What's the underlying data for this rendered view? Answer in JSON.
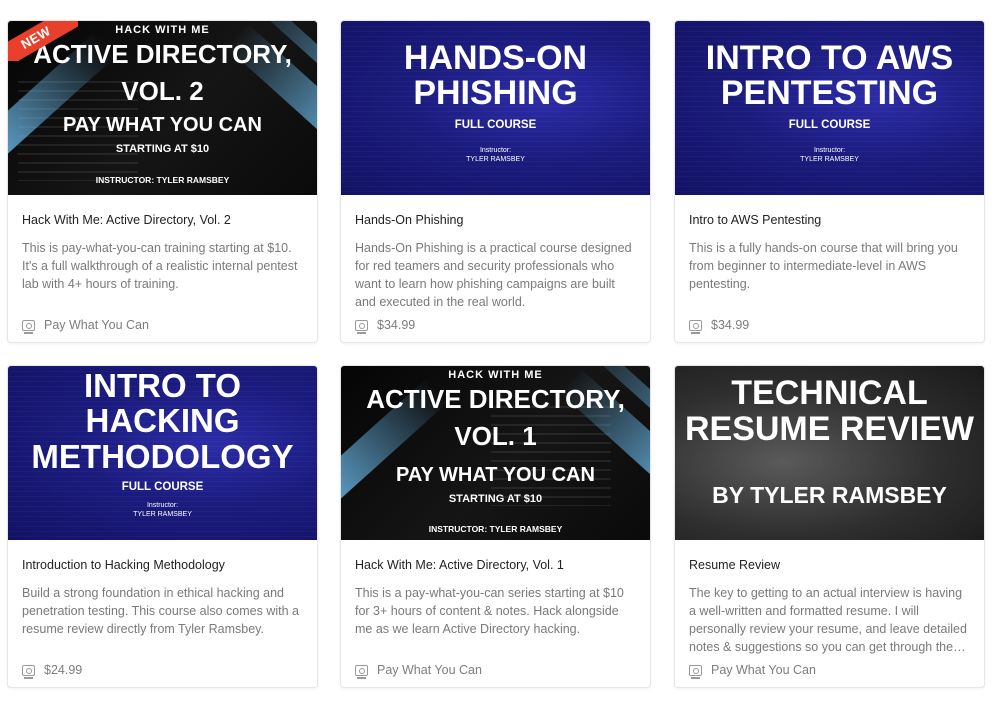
{
  "courses": [
    {
      "badge": "NEW",
      "thumb_lines": [
        "HACK WITH ME",
        "ACTIVE DIRECTORY,",
        "VOL. 2",
        "PAY WHAT YOU CAN",
        "STARTING AT $10",
        "INSTRUCTOR: TYLER RAMSBEY"
      ],
      "title": "Hack With Me: Active Directory, Vol. 2",
      "description": "This is pay-what-you-can training starting at $10. It's a full walkthrough of a realistic internal pentest lab with 4+ hours of training.",
      "price": "Pay What You Can"
    },
    {
      "thumb_lines": [
        "HANDS-ON",
        "PHISHING",
        "FULL COURSE",
        "Instructor:",
        "TYLER RAMSBEY"
      ],
      "title": "Hands-On Phishing",
      "description": "Hands-On Phishing is a practical course designed for red teamers and security professionals who want to learn how phishing campaigns are built and executed in the real world.",
      "price": "$34.99"
    },
    {
      "thumb_lines": [
        "INTRO TO AWS",
        "PENTESTING",
        "FULL COURSE",
        "Instructor:",
        "TYLER RAMSBEY"
      ],
      "title": "Intro to AWS Pentesting",
      "description": "This is a fully hands-on course that will bring you from beginner to intermediate-level in AWS pentesting.",
      "price": "$34.99"
    },
    {
      "thumb_lines": [
        "INTRO TO",
        "HACKING",
        "METHODOLOGY",
        "FULL COURSE",
        "Instructor:",
        "TYLER RAMSBEY"
      ],
      "title": "Introduction to Hacking Methodology",
      "description": "Build a strong foundation in ethical hacking and penetration testing. This course also comes with a resume review directly from Tyler Ramsbey.",
      "price": "$24.99"
    },
    {
      "thumb_lines": [
        "HACK WITH ME",
        "ACTIVE DIRECTORY,",
        "VOL. 1",
        "PAY WHAT YOU CAN",
        "STARTING AT $10",
        "INSTRUCTOR: TYLER RAMSBEY"
      ],
      "title": "Hack With Me: Active Directory, Vol. 1",
      "description": "This is a pay-what-you-can series starting at $10 for 3+ hours of content & notes. Hack alongside me as we learn Active Directory hacking.",
      "price": "Pay What You Can"
    },
    {
      "thumb_lines": [
        "TECHNICAL",
        "RESUME REVIEW",
        "BY TYLER RAMSBEY"
      ],
      "title": "Resume Review",
      "description": "The key to getting to an actual interview is having a well-written and formatted resume. I will personally review your resume, and leave detailed notes & suggestions so you can get through the…",
      "price": "Pay What You Can"
    }
  ],
  "colors": {
    "badge": "#e8402a",
    "text": "#222222",
    "muted": "#7a7a7a",
    "blue_thumb": "#1b1b7e"
  }
}
